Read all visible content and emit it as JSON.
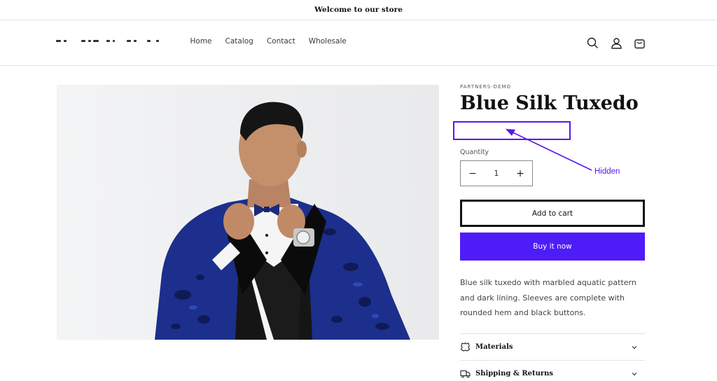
{
  "announcement": {
    "text": "Welcome to our store"
  },
  "header": {
    "nav": [
      {
        "label": "Home"
      },
      {
        "label": "Catalog"
      },
      {
        "label": "Contact"
      },
      {
        "label": "Wholesale"
      }
    ],
    "icons": [
      "search-icon",
      "account-icon",
      "cart-icon"
    ]
  },
  "product": {
    "vendor": "PARTNERS-DEMO",
    "title": "Blue Silk Tuxedo",
    "quantity_label": "Quantity",
    "quantity_value": "1",
    "decrease_symbol": "−",
    "increase_symbol": "+",
    "add_to_cart": "Add to cart",
    "buy_now": "Buy it now",
    "description": "Blue silk tuxedo with marbled aquatic pattern and dark lining. Sleeves are complete with rounded hem and black buttons."
  },
  "annotation": {
    "label": "Hidden",
    "color": "#5a17ee"
  },
  "accordions": [
    {
      "label": "Materials",
      "icon": "leather-icon"
    },
    {
      "label": "Shipping & Returns",
      "icon": "truck-icon"
    }
  ],
  "colors": {
    "accent": "#4e1cf8",
    "text": "#121212",
    "annotation": "#5a17ee"
  }
}
